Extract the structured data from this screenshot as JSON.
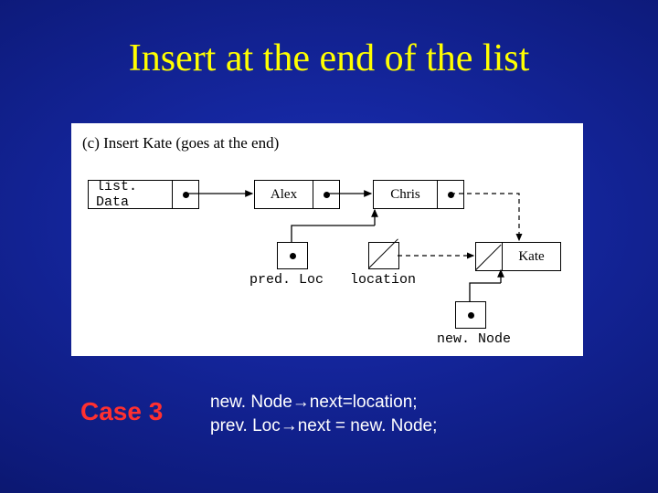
{
  "title": "Insert at the end of the list",
  "figure": {
    "caption": "(c) Insert Kate (goes at the end)",
    "listData_label": "list. Data",
    "node1": "Alex",
    "node2": "Chris",
    "node3": "Kate",
    "predLoc_label": "pred. Loc",
    "location_label": "location",
    "newNode_label": "new. Node"
  },
  "case_label": "Case 3",
  "code_line1": "new. Node  next=location;",
  "code_line2": "prev. Loc  next = new. Node;",
  "arrow_glyph": "→"
}
